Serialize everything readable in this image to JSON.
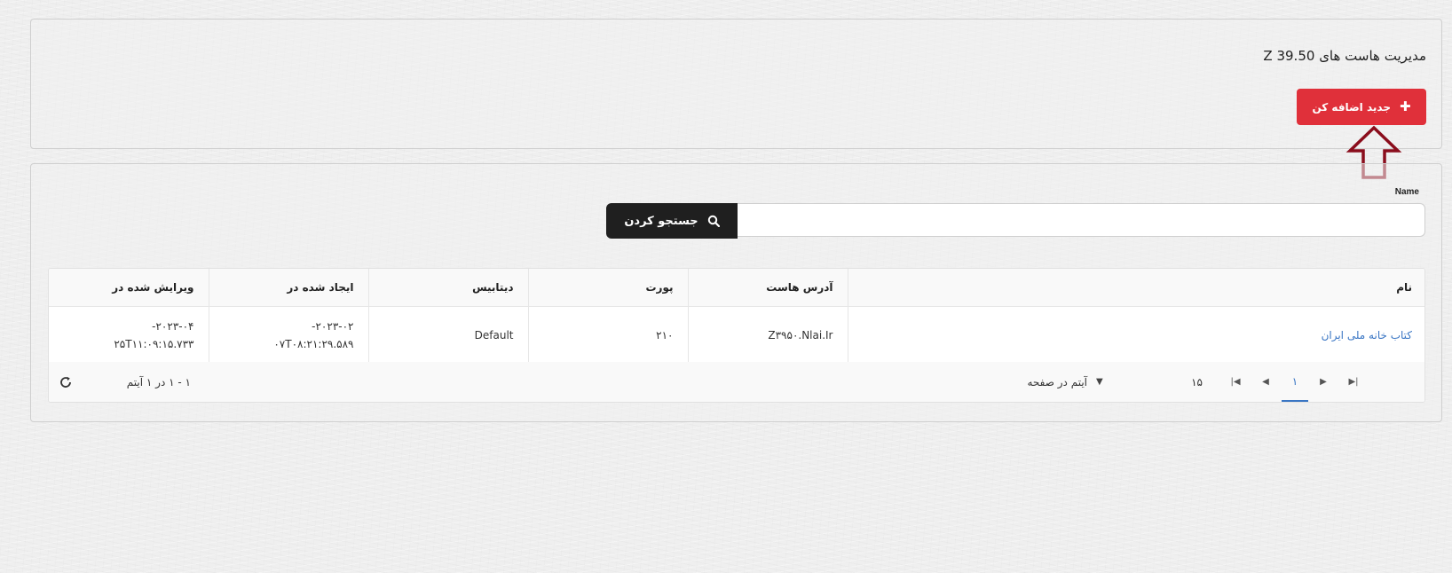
{
  "header": {
    "title": "مدیریت هاست های Z 39.50",
    "add_button_label": "جدید اضافه کن"
  },
  "search": {
    "label": "Name",
    "value": "",
    "placeholder": "",
    "button_label": "جستجو کردن"
  },
  "table": {
    "columns": [
      "نام",
      "آدرس هاست",
      "پورت",
      "دیتابیس",
      "ایجاد شده در",
      "ویرایش شده در"
    ],
    "rows": [
      {
        "name": "کتاب خانه ملی ایران",
        "host": "Z۳۹۵۰.Nlai.Ir",
        "port": "۲۱۰",
        "database": "Default",
        "created_line1": "۲۰۲۳-۰۲-",
        "created_line2": "۰۷T۰۸:۲۱:۲۹.۵۸۹",
        "updated_line1": "۲۰۲۳-۰۴-",
        "updated_line2": "۲۵T۱۱:۰۹:۱۵.۷۳۳"
      }
    ]
  },
  "pager": {
    "current_page": "۱",
    "page_size": "۱۵",
    "items_per_page_label": "آیتم در صفحه",
    "summary": "۱ - ۱ در ۱ آیتم"
  },
  "icons": {
    "add": "plus-icon",
    "search": "search-icon",
    "refresh": "refresh-icon",
    "first": "first-page-icon",
    "prev": "prev-page-icon",
    "next": "next-page-icon",
    "last": "last-page-icon"
  },
  "colors": {
    "accent_red": "#e0303a",
    "dark_button": "#1f1f1f",
    "link_blue": "#3a76c4",
    "arrow": "#8a0d1c"
  }
}
